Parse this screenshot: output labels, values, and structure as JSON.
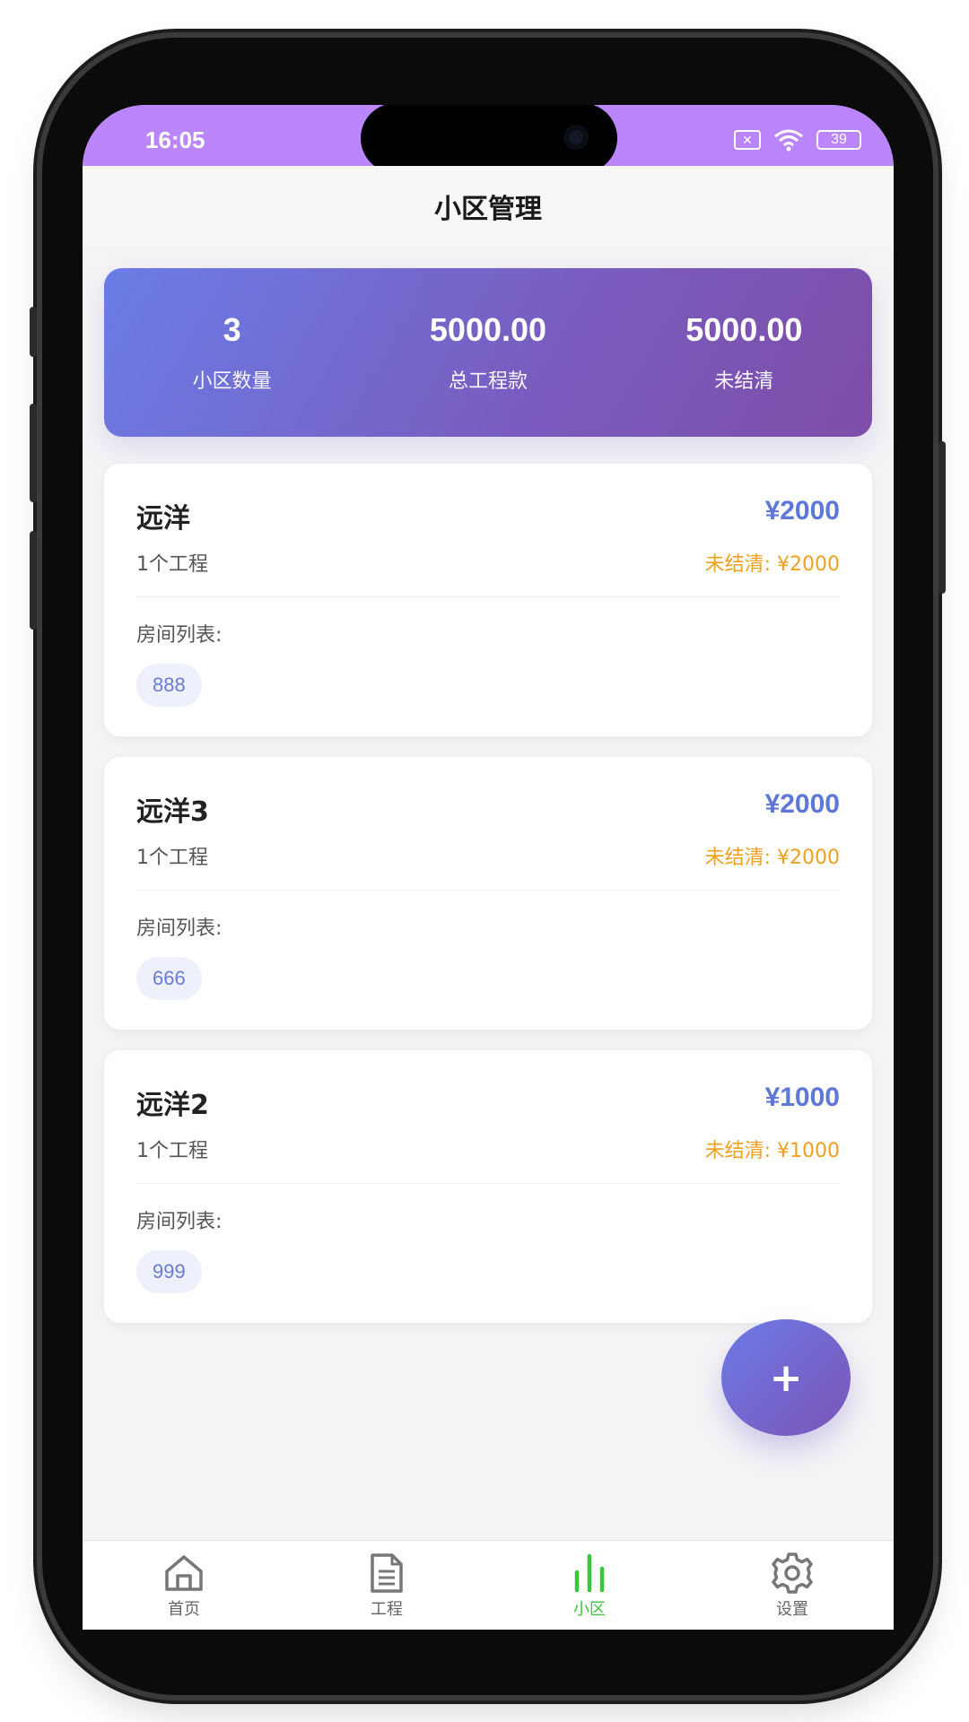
{
  "status_bar": {
    "time": "16:05",
    "battery": "39"
  },
  "header": {
    "title": "小区管理"
  },
  "summary": {
    "stats": [
      {
        "value": "3",
        "label": "小区数量"
      },
      {
        "value": "5000.00",
        "label": "总工程款"
      },
      {
        "value": "5000.00",
        "label": "未结清"
      }
    ]
  },
  "communities": [
    {
      "name": "远洋",
      "amount": "¥2000",
      "projects": "1个工程",
      "unpaid": "未结清: ¥2000",
      "rooms_label": "房间列表:",
      "rooms": [
        "888"
      ]
    },
    {
      "name": "远洋3",
      "amount": "¥2000",
      "projects": "1个工程",
      "unpaid": "未结清: ¥2000",
      "rooms_label": "房间列表:",
      "rooms": [
        "666"
      ]
    },
    {
      "name": "远洋2",
      "amount": "¥1000",
      "projects": "1个工程",
      "unpaid": "未结清: ¥1000",
      "rooms_label": "房间列表:",
      "rooms": [
        "999"
      ]
    }
  ],
  "fab": {
    "label": "+"
  },
  "tabs": [
    {
      "label": "首页",
      "icon": "home-icon"
    },
    {
      "label": "工程",
      "icon": "document-icon"
    },
    {
      "label": "小区",
      "icon": "bar-chart-icon",
      "active": true
    },
    {
      "label": "设置",
      "icon": "gear-icon"
    }
  ],
  "colors": {
    "accent": "#5f77d8",
    "warning": "#f0a020",
    "active_tab": "#3bc43b",
    "status_bar": "#bb86fc"
  }
}
